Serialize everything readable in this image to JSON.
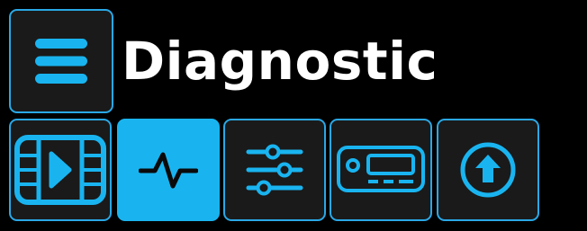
{
  "header": {
    "title": "Diagnostic",
    "menu_icon": "hamburger-menu-icon"
  },
  "tabs": [
    {
      "id": "video",
      "icon": "video-film-icon",
      "active": false
    },
    {
      "id": "diagnostic",
      "icon": "pulse-waveform-icon",
      "active": true
    },
    {
      "id": "settings",
      "icon": "sliders-icon",
      "active": false
    },
    {
      "id": "device",
      "icon": "device-radio-icon",
      "active": false
    },
    {
      "id": "upload",
      "icon": "upload-arrow-icon",
      "active": false
    }
  ],
  "colors": {
    "accent": "#19b4f0",
    "tile_border": "#2aa8e6",
    "tile_background": "#1a1a1a",
    "page_background": "#000000",
    "title_text": "#ffffff",
    "active_icon": "#0a0a0a"
  }
}
